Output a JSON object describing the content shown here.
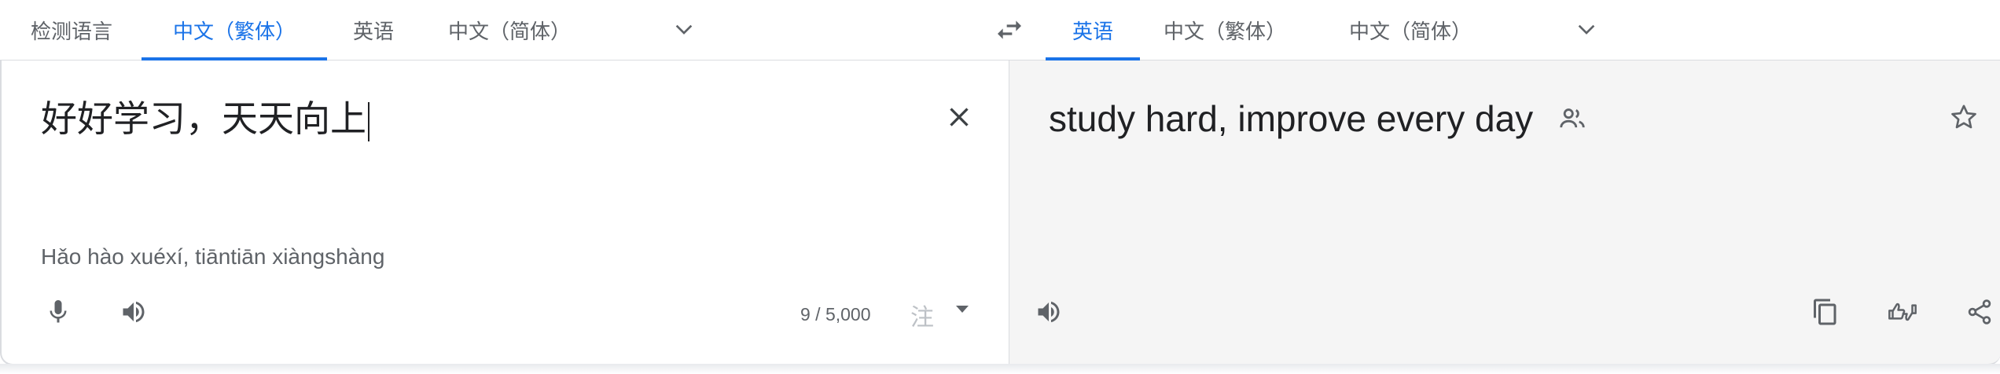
{
  "source_tabs": [
    "检测语言",
    "中文（繁体）",
    "英语",
    "中文（简体）"
  ],
  "target_tabs": [
    "英语",
    "中文（繁体）",
    "中文（简体）"
  ],
  "source": {
    "text": "好好学习，天天向上",
    "romanization": "Hǎo hào xuéxí, tiāntiān xiàngshàng",
    "char_count": "9 / 5,000",
    "ime_label": "注"
  },
  "target": {
    "text": "study hard, improve every day"
  },
  "icons": {
    "source_lang_more": "chevron-down-icon",
    "swap": "swap-languages-icon",
    "target_lang_more": "chevron-down-icon",
    "clear": "close-icon",
    "mic": "microphone-icon",
    "listen_source": "speaker-icon",
    "community": "people-icon",
    "star": "star-icon",
    "listen_target": "speaker-icon",
    "copy": "copy-icon",
    "feedback": "thumbs-feedback-icon",
    "share": "share-icon"
  },
  "colors": {
    "accent": "#1a73e8",
    "text": "#202124",
    "muted": "#5f6368",
    "target_bg": "#f5f5f5"
  }
}
